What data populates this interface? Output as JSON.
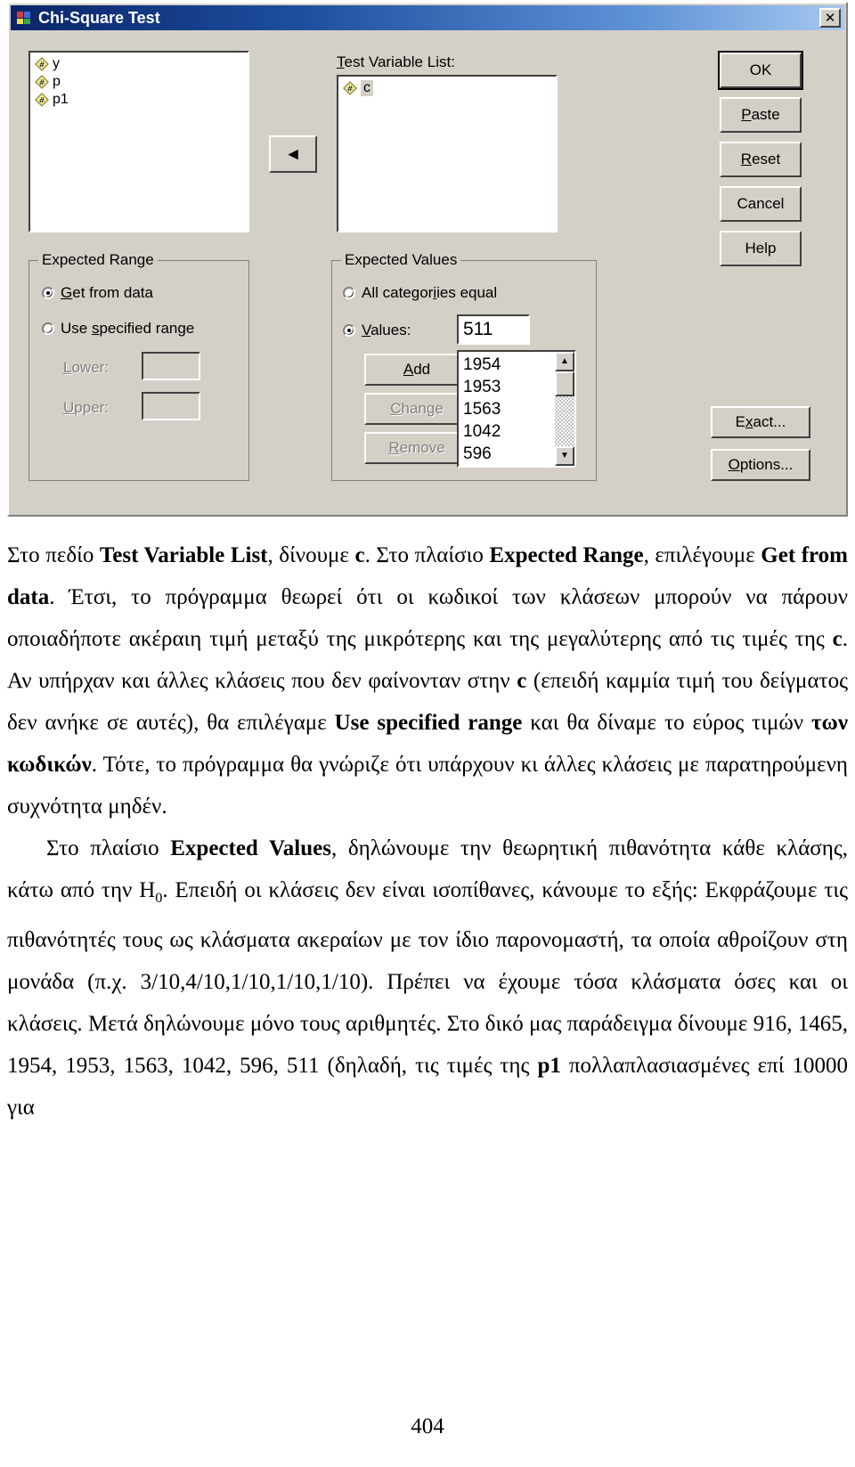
{
  "dialog": {
    "title": "Chi-Square Test",
    "close_label": "✕",
    "source_variables": [
      {
        "icon": "numeric-variable-icon",
        "name": "y"
      },
      {
        "icon": "numeric-variable-icon",
        "name": "p"
      },
      {
        "icon": "numeric-variable-icon",
        "name": "p1"
      }
    ],
    "move_button_glyph": "◄",
    "test_variable_list": {
      "label": "Test Variable List:",
      "items": [
        {
          "icon": "numeric-variable-icon",
          "name": "c"
        }
      ]
    },
    "command_buttons": [
      {
        "key": "ok",
        "label": "OK",
        "default": true
      },
      {
        "key": "paste",
        "label": "Paste"
      },
      {
        "key": "reset",
        "label": "Reset"
      },
      {
        "key": "cancel",
        "label": "Cancel"
      },
      {
        "key": "help",
        "label": "Help"
      }
    ],
    "extra_buttons": [
      {
        "key": "exact",
        "label": "Exact..."
      },
      {
        "key": "options",
        "label": "Options..."
      }
    ],
    "expected_range": {
      "title": "Expected Range",
      "options": [
        {
          "key": "get-from-data",
          "label": "Get from data",
          "selected": true
        },
        {
          "key": "use-specified-range",
          "label": "Use specified range",
          "selected": false
        }
      ],
      "lower_label": "Lower:",
      "lower_value": "",
      "upper_label": "Upper:",
      "upper_value": ""
    },
    "expected_values": {
      "title": "Expected Values",
      "options": [
        {
          "key": "all-categories-equal",
          "label": "All categories equal",
          "selected": false
        },
        {
          "key": "values",
          "label": "Values:",
          "selected": true
        }
      ],
      "values_input": "511",
      "buttons": [
        {
          "key": "add",
          "label": "Add",
          "disabled": false
        },
        {
          "key": "change",
          "label": "Change",
          "disabled": true
        },
        {
          "key": "remove",
          "label": "Remove",
          "disabled": true
        }
      ],
      "values_list": [
        "1954",
        "1953",
        "1563",
        "1042",
        "596"
      ],
      "scroll_up_glyph": "▲",
      "scroll_down_glyph": "▼"
    }
  },
  "document": {
    "paragraph1_html": "Στο πεδίο <b>Test Variable List</b>, δίνουμε <b>c</b>. Στο πλαίσιο <b>Expected Range</b>, επιλέγουμε <b>Get from data</b>. Έτσι, το πρόγραμμα θεωρεί ότι οι κωδικοί των κλάσεων μπορούν να πάρουν οποιαδήποτε ακέραιη τιμή μεταξύ της μικρότερης και της μεγαλύτερης από τις τιμές της <b>c</b>. Αν υπήρχαν και άλλες κλάσεις που δεν φαίνονταν στην <b>c</b> (επειδή καμμία τιμή του δείγματος δεν ανήκε σε αυτές), θα επιλέγαμε <b>Use specified range</b> και θα δίναμε το εύρος τιμών <b>των κωδικών</b>. Τότε, το πρόγραμμα θα γνώριζε ότι υπάρχουν κι άλλες κλάσεις με παρατηρούμενη συχνότητα μηδέν.",
    "paragraph2_html": "Στο πλαίσιο <b>Expected Values</b>, δηλώνουμε την θεωρητική πιθανότητα κάθε κλάσης, κάτω από την H<sub>0</sub>. Επειδή οι κλάσεις δεν είναι ισοπίθανες, κάνουμε το εξής: Εκφράζουμε τις πιθανότητές τους ως κλάσματα ακεραίων με τον ίδιο παρονομαστή, τα οποία αθροίζουν στη μονάδα (π.χ. 3/10,4/10,1/10,1/10,1/10). Πρέπει να έχουμε τόσα κλάσματα όσες και οι κλάσεις. Μετά δηλώνουμε μόνο τους αριθμητές. Στο δικό μας παράδειγμα δίνουμε 916, 1465, 1954, 1953, 1563, 1042, 596, 511 (δηλαδή, τις τιμές της <b>p1</b> πολλαπλασιασμένες επί 10000 για",
    "page_number": "404"
  },
  "colors": {
    "dialog_face": "#d4d0c8",
    "titlebar_start": "#0a246a",
    "titlebar_end": "#a6c8ef",
    "variable_icon": "#f5f0a0",
    "text": "#000000"
  }
}
